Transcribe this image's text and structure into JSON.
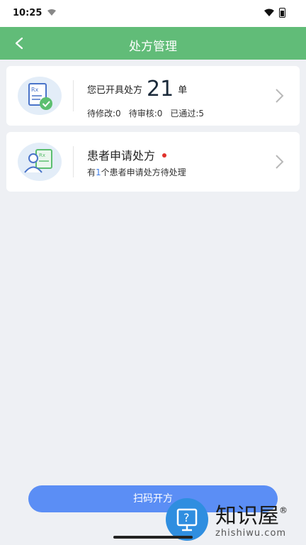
{
  "status_bar": {
    "time": "10:25"
  },
  "header": {
    "title": "处方管理",
    "back_icon": "chevron-left-icon"
  },
  "cards": [
    {
      "title_prefix": "您已开具处方",
      "count": "21",
      "title_suffix": "单",
      "stats": [
        "待修改:0",
        "待审核:0",
        "已通过:5"
      ],
      "icon": "prescription-approved-icon"
    },
    {
      "title": "患者申请处方",
      "sub_prefix": "有",
      "sub_count": "1",
      "sub_suffix": "个患者申请处方待处理",
      "icon": "patient-prescription-icon",
      "badge_color": "#e0322c"
    }
  ],
  "scan_button": {
    "label": "扫码开方"
  },
  "watermark": {
    "text": "知识屋",
    "mark": "®",
    "url": "zhishiwu.com"
  },
  "colors": {
    "header": "#61bc78",
    "button": "#5b8ef5",
    "accent": "#3f7ee8"
  }
}
